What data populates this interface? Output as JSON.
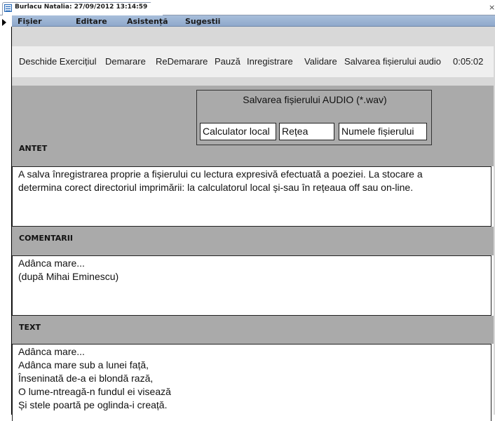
{
  "tab": {
    "title": "Burlacu Natalia: 27/09/2012 13:14:59",
    "close": "×"
  },
  "menu": [
    "Fișier",
    "Editare",
    "Asistență",
    "Sugestii"
  ],
  "toolbar": {
    "buttons": [
      "Deschide Exercițiul",
      "Demarare",
      "ReDemarare",
      "Pauză",
      "Inregistrare",
      "Validare",
      "Salvarea fișierului audio"
    ],
    "timer": "0:05:02"
  },
  "audio_panel": {
    "title": "Salvarea fișierului AUDIO (*.wav)",
    "buttons": [
      "Calculator local",
      "Rețea",
      "Numele fișierului"
    ]
  },
  "sections": {
    "antet": {
      "label": "ANTET",
      "lines": [
        "A salva înregistrarea proprie a fișierului cu lectura expresivă efectuată a poeziei. La stocare a",
        "determina corect directoriul imprimării: la calculatorul local și-sau în rețeaua off sau on-line."
      ]
    },
    "comentarii": {
      "label": "COMENTARII",
      "lines": [
        "Adânca mare...",
        "(după Mihai Eminescu)"
      ]
    },
    "text": {
      "label": "TEXT",
      "lines": [
        "Adânca mare...",
        "Adânca mare sub a lunei față,",
        "Înseninată de-a ei blondă rază,",
        "O lume-ntreagă-n fundul ei visează",
        "Și stele poartă pe oglinda-i creață."
      ]
    }
  }
}
